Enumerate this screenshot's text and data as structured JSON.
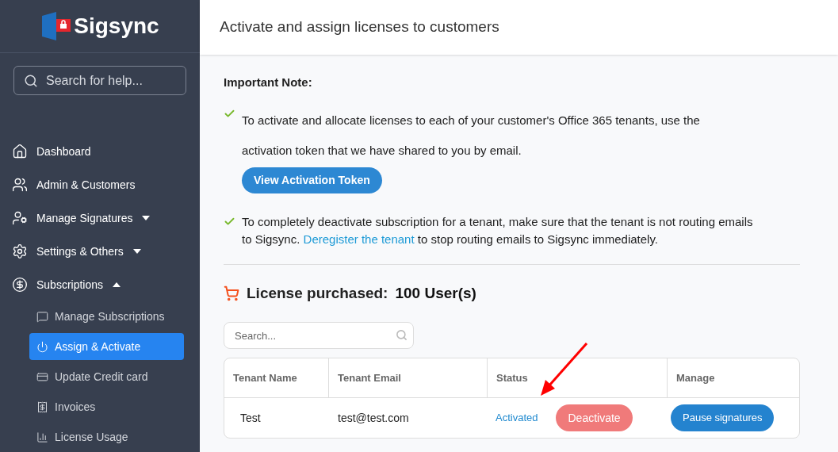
{
  "sidebar": {
    "logo": {
      "text": "Sigsync"
    },
    "search": {
      "placeholder": "Search for help..."
    },
    "items": [
      {
        "label": "Dashboard"
      },
      {
        "label": "Admin & Customers"
      },
      {
        "label": "Manage Signatures",
        "expanded": false
      },
      {
        "label": "Settings & Others",
        "expanded": false
      },
      {
        "label": "Subscriptions",
        "expanded": true,
        "children": [
          {
            "label": "Manage Subscriptions",
            "selected": false
          },
          {
            "label": "Assign & Activate",
            "selected": true
          },
          {
            "label": "Update Credit card",
            "selected": false
          },
          {
            "label": "Invoices",
            "selected": false
          },
          {
            "label": "License Usage",
            "selected": false
          }
        ]
      }
    ]
  },
  "header": {
    "title": "Activate and assign licenses to customers"
  },
  "note": {
    "heading": "Important Note:",
    "item_1": {
      "text": "To activate and allocate licenses to each of your customer's Office 365 tenants, use the activation token that we have shared to you by email.",
      "button": "View Activation Token"
    },
    "item_2": {
      "text_before": "To completely deactivate subscription for a tenant, make sure that the tenant is not routing emails to Sigsync.",
      "link": "Deregister the tenant",
      "text_after": "to stop routing emails to Sigsync immediately."
    }
  },
  "license": {
    "label": "License purchased:",
    "value": "100 User(s)"
  },
  "table": {
    "search": {
      "placeholder": "Search..."
    },
    "columns": [
      "Tenant Name",
      "Tenant Email",
      "Status",
      "Manage"
    ],
    "rows": [
      {
        "tenant_name": "Test",
        "tenant_email": "test@test.com",
        "status": "Activated",
        "action": "Deactivate",
        "manage": "Pause signatures"
      }
    ]
  }
}
